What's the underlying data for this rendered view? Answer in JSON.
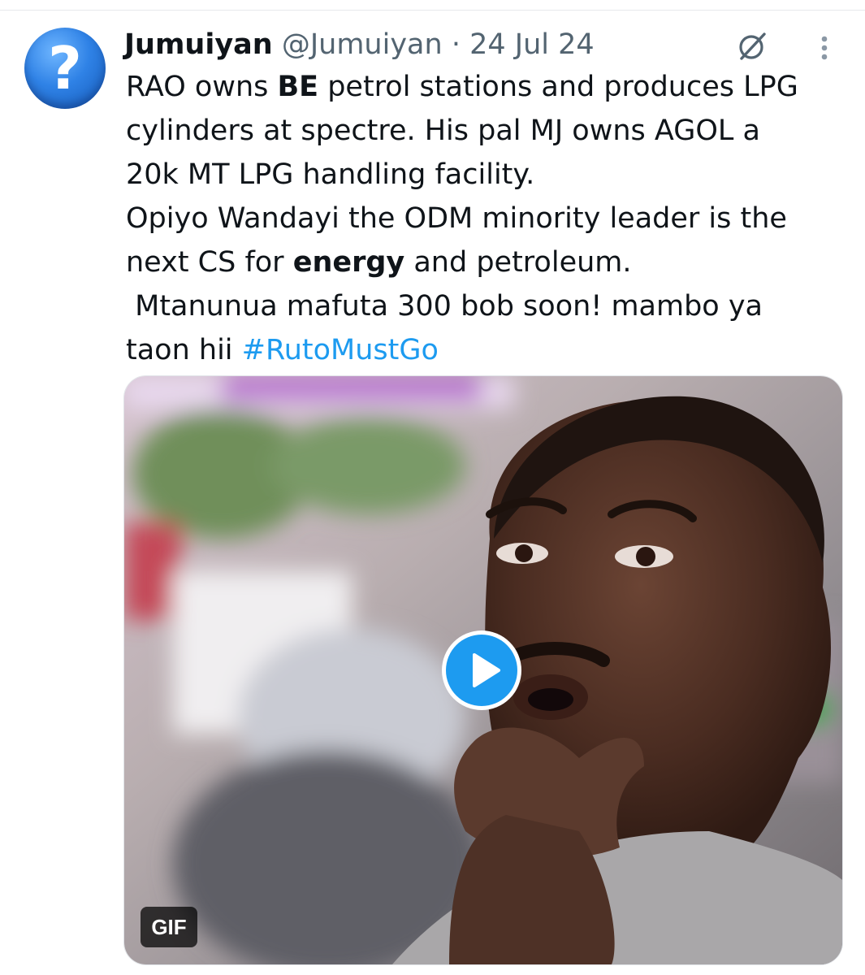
{
  "tweet": {
    "author_name": "Jumuiyan",
    "author_handle": "@Jumuiyan",
    "separator": "·",
    "date": "24 Jul 24",
    "avatar_icon": "question-mark-icon",
    "avatar_symbol": "?",
    "text_lines": [
      {
        "pre": "RAO owns ",
        "bold": "BE",
        "post": " petrol stations and produces LPG"
      },
      {
        "pre": "cylinders at spectre. His pal MJ owns AGOL a"
      },
      {
        "pre": "20k MT LPG handling facility."
      },
      {
        "pre": "Opiyo Wandayi the ODM minority leader is the"
      },
      {
        "pre": "next CS for ",
        "bold": "energy",
        "post": " and petroleum."
      },
      {
        "pre": " Mtanunua mafuta 300 bob soon! mambo ya"
      },
      {
        "pre": "taon hii ",
        "hashtag": "#RutoMustGo"
      }
    ],
    "hashtag_color": "#1d9bf0",
    "media": {
      "type": "gif",
      "badge_label": "GIF",
      "play_icon": "play-icon"
    },
    "actions": {
      "grok_icon": "grok-icon",
      "more_icon": "more-options-icon"
    }
  }
}
